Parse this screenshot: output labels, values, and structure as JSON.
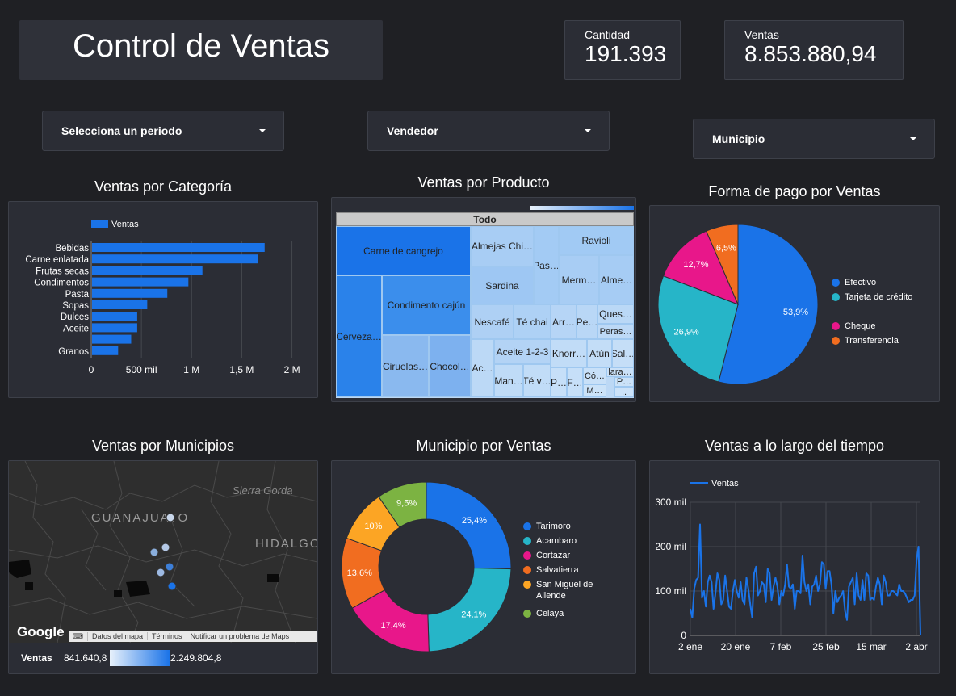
{
  "header": {
    "title": "Control de Ventas"
  },
  "kpis": {
    "cantidad_label": "Cantidad",
    "cantidad_value": "191.393",
    "ventas_label": "Ventas",
    "ventas_value": "8.853.880,94"
  },
  "filters": {
    "periodo": "Selecciona un periodo",
    "vendedor": "Vendedor",
    "municipio": "Municipio"
  },
  "titles": {
    "categoria": "Ventas por Categoría",
    "producto": "Ventas por Producto",
    "pago": "Forma de pago por Ventas",
    "municipios": "Ventas por Municipios",
    "municipio_ventas": "Municipio por Ventas",
    "tiempo": "Ventas a lo largo del tiempo"
  },
  "colors": {
    "accent": "#1a73e8",
    "bg": "#1f2024",
    "card": "#2b2d35"
  },
  "chart_data": [
    {
      "type": "bar",
      "orientation": "horizontal",
      "title": "Ventas por Categoría",
      "legend": "Ventas",
      "legend_position": "top-left",
      "categories": [
        "Bebidas",
        "Carne enlatada",
        "Frutas secas",
        "Condimentos",
        "Pasta",
        "Sopas",
        "Dulces",
        "Aceite",
        "",
        "Granos"
      ],
      "values": [
        1720000,
        1650000,
        1100000,
        960000,
        750000,
        550000,
        450000,
        450000,
        390000,
        260000
      ],
      "xticks": [
        "0",
        "500 mil",
        "1 M",
        "1,5 M",
        "2 M"
      ],
      "xlim": [
        0,
        2100000
      ]
    },
    {
      "type": "treemap",
      "title": "Ventas por Producto",
      "root": "Todo",
      "items": [
        "Carne de cangrejo",
        "Cerveza…",
        "Condimento cajún",
        "Ciruelas…",
        "Chocol…",
        "Almejas Chi…",
        "Sardina",
        "Pas…",
        "Ravioli",
        "Merm…",
        "Alme…",
        "Nescafé",
        "Té chai",
        "Arr…",
        "Pe…",
        "Ques…",
        "Peras…",
        "Aceite 1-2-3",
        "Ac…",
        "Man…",
        "Té v…",
        "Knorr…",
        "Atún",
        "Sal…",
        "P…",
        "F…",
        "Có…",
        "lara…",
        "P…",
        "M…",
        ".."
      ]
    },
    {
      "type": "pie",
      "title": "Forma de pago por Ventas",
      "legend_position": "right",
      "series": [
        {
          "name": "Efectivo",
          "value": 53.9,
          "label": "53,9%",
          "color": "#1a73e8"
        },
        {
          "name": "Tarjeta de crédito",
          "value": 26.9,
          "label": "26,9%",
          "color": "#26b5c8"
        },
        {
          "name": "Cheque",
          "value": 12.7,
          "label": "12,7%",
          "color": "#e8178a"
        },
        {
          "name": "Transferencia",
          "value": 6.5,
          "label": "6,5%",
          "color": "#f16d20"
        }
      ]
    },
    {
      "type": "map",
      "title": "Ventas por Municipios",
      "labels": [
        "Sierra Gorda",
        "GUANAJUATO",
        "HIDALGO"
      ],
      "attribution": [
        "Google",
        "Datos del mapa",
        "Términos",
        "Notificar un problema de Maps"
      ],
      "scale_label": "Ventas",
      "scale_min": "841.640,8",
      "scale_max": "2.249.804,8"
    },
    {
      "type": "donut",
      "title": "Municipio por Ventas",
      "legend_position": "right",
      "series": [
        {
          "name": "Tarimoro",
          "value": 25.4,
          "label": "25,4%",
          "color": "#1a73e8"
        },
        {
          "name": "Acambaro",
          "value": 24.1,
          "label": "24,1%",
          "color": "#26b5c8"
        },
        {
          "name": "Cortazar",
          "value": 17.4,
          "label": "17,4%",
          "color": "#e8178a"
        },
        {
          "name": "Salvatierra",
          "value": 13.6,
          "label": "13,6%",
          "color": "#f16d20"
        },
        {
          "name": "San Miguel de Allende",
          "value": 10,
          "label": "10%",
          "color": "#fca524"
        },
        {
          "name": "Celaya",
          "value": 9.5,
          "label": "9,5%",
          "color": "#7cb342"
        }
      ]
    },
    {
      "type": "line",
      "title": "Ventas a lo largo del tiempo",
      "series": [
        {
          "name": "Ventas",
          "color": "#1a73e8",
          "values": [
            60000,
            40000,
            105000,
            125000,
            130000,
            250000,
            85000,
            100000,
            65000,
            120000,
            135000,
            120000,
            60000,
            95000,
            140000,
            125000,
            70000,
            80000,
            135000,
            100000,
            65000,
            60000,
            100000,
            125000,
            100000,
            85000,
            120000,
            80000,
            70000,
            130000,
            105000,
            70000,
            40000,
            140000,
            155000,
            90000,
            100000,
            120000,
            115000,
            75000,
            150000,
            140000,
            80000,
            110000,
            130000,
            110000,
            70000,
            100000,
            90000,
            115000,
            160000,
            110000,
            105000,
            115000,
            60000,
            100000,
            100000,
            95000,
            180000,
            120000,
            100000,
            115000,
            70000,
            110000,
            115000,
            135000,
            100000,
            115000,
            165000,
            160000,
            105000,
            145000,
            145000,
            115000,
            50000,
            100000,
            75000,
            85000,
            90000,
            100000,
            55000,
            35000,
            110000,
            120000,
            130000,
            70000,
            140000,
            90000,
            80000,
            125000,
            80000,
            140000,
            135000,
            80000,
            85000,
            80000,
            110000,
            130000,
            115000,
            70000,
            135000,
            120000,
            90000,
            90000,
            100000,
            100000,
            95000,
            90000,
            115000,
            100000,
            100000,
            95000,
            85000,
            75000,
            80000,
            80000,
            90000,
            170000,
            200000,
            0
          ]
        }
      ],
      "xticks": [
        "2 ene",
        "20 ene",
        "7 feb",
        "25 feb",
        "15 mar",
        "2 abr"
      ],
      "yticks": [
        "0",
        "100 mil",
        "200 mil",
        "300 mil"
      ],
      "ylim": [
        0,
        300000
      ],
      "grid": true,
      "legend_position": "top-left"
    }
  ]
}
